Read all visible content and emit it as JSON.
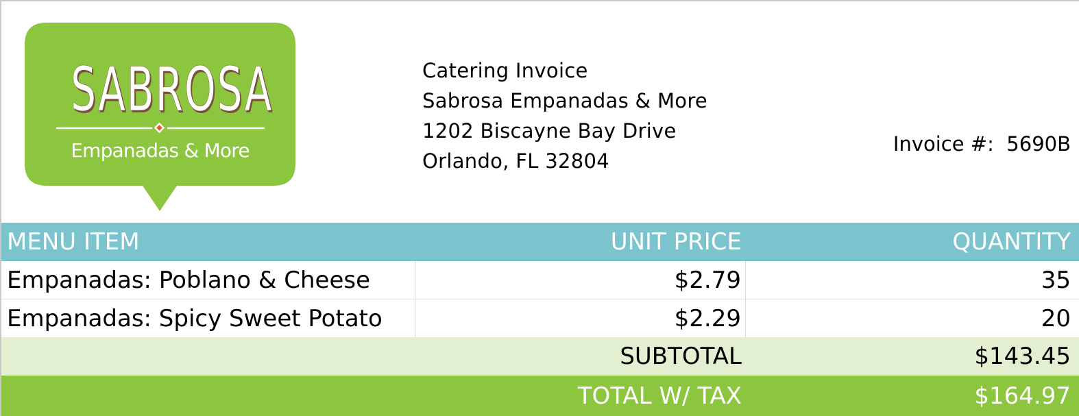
{
  "logo": {
    "name": "SABROSA",
    "tagline": "Empanadas & More",
    "colors": {
      "badge": "#8cc63f",
      "letter_shadow": "#7a4f3c",
      "diamond": "#e8533b"
    }
  },
  "address": {
    "line1": "Catering Invoice",
    "line2": "Sabrosa Empanadas & More",
    "line3": "1202 Biscayne Bay Drive",
    "line4": "Orlando, FL 32804"
  },
  "invoice": {
    "label": "Invoice #:",
    "number": "5690B"
  },
  "table": {
    "headers": {
      "item": "MENU ITEM",
      "price": "UNIT PRICE",
      "quantity": "QUANTITY"
    },
    "rows": [
      {
        "item": "Empanadas: Poblano & Cheese",
        "price": "$2.79",
        "quantity": "35"
      },
      {
        "item": "Empanadas: Spicy Sweet Potato",
        "price": "$2.29",
        "quantity": "20"
      }
    ],
    "subtotal": {
      "label": "SUBTOTAL",
      "value": "$143.45"
    },
    "total": {
      "label": "TOTAL W/ TAX",
      "value": "$164.97"
    }
  },
  "colors": {
    "header_bg": "#7bc4cd",
    "subtotal_bg": "#e3efd1",
    "total_bg": "#8cc63f"
  }
}
